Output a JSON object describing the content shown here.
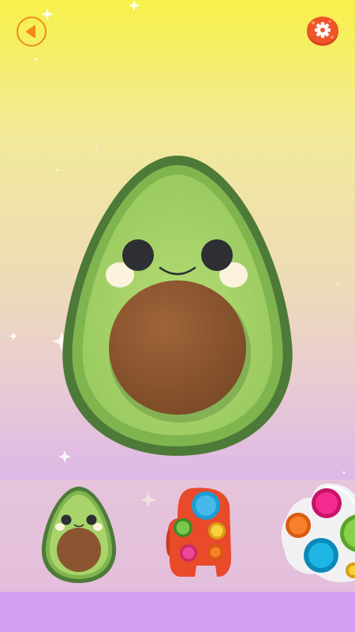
{
  "screen": {
    "colors": {
      "background_top": "#f7f14a",
      "background_bottom": "#d6a8ee",
      "accent": "#f28a1a",
      "avocado_outer": "#4f7f3a",
      "avocado_flesh": "#a8d46a",
      "pit": "#8a5530"
    }
  },
  "toolbar": {
    "back_icon": "back-arrow-icon",
    "settings_icon": "gear-icon"
  },
  "main_toy": {
    "name": "avocado-squishy"
  },
  "tray": {
    "items": [
      {
        "icon": "avocado-icon"
      },
      {
        "icon": "pop-it-crewmate-icon"
      },
      {
        "icon": "pop-it-flower-icon"
      }
    ]
  }
}
